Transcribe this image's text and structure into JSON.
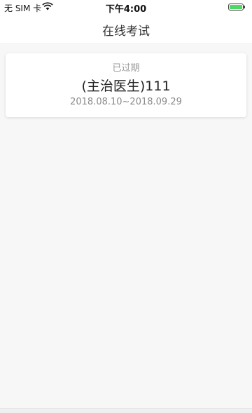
{
  "status_bar": {
    "carrier": "无 SIM 卡",
    "time": "下午4:00",
    "icons": [
      "wifi-icon",
      "battery-icon"
    ],
    "battery_color": "#4cd964"
  },
  "nav": {
    "title": "在线考试"
  },
  "exams": [
    {
      "status": "已过期",
      "name": "(主治医生)111",
      "dates": "2018.08.10~2018.09.29"
    }
  ]
}
